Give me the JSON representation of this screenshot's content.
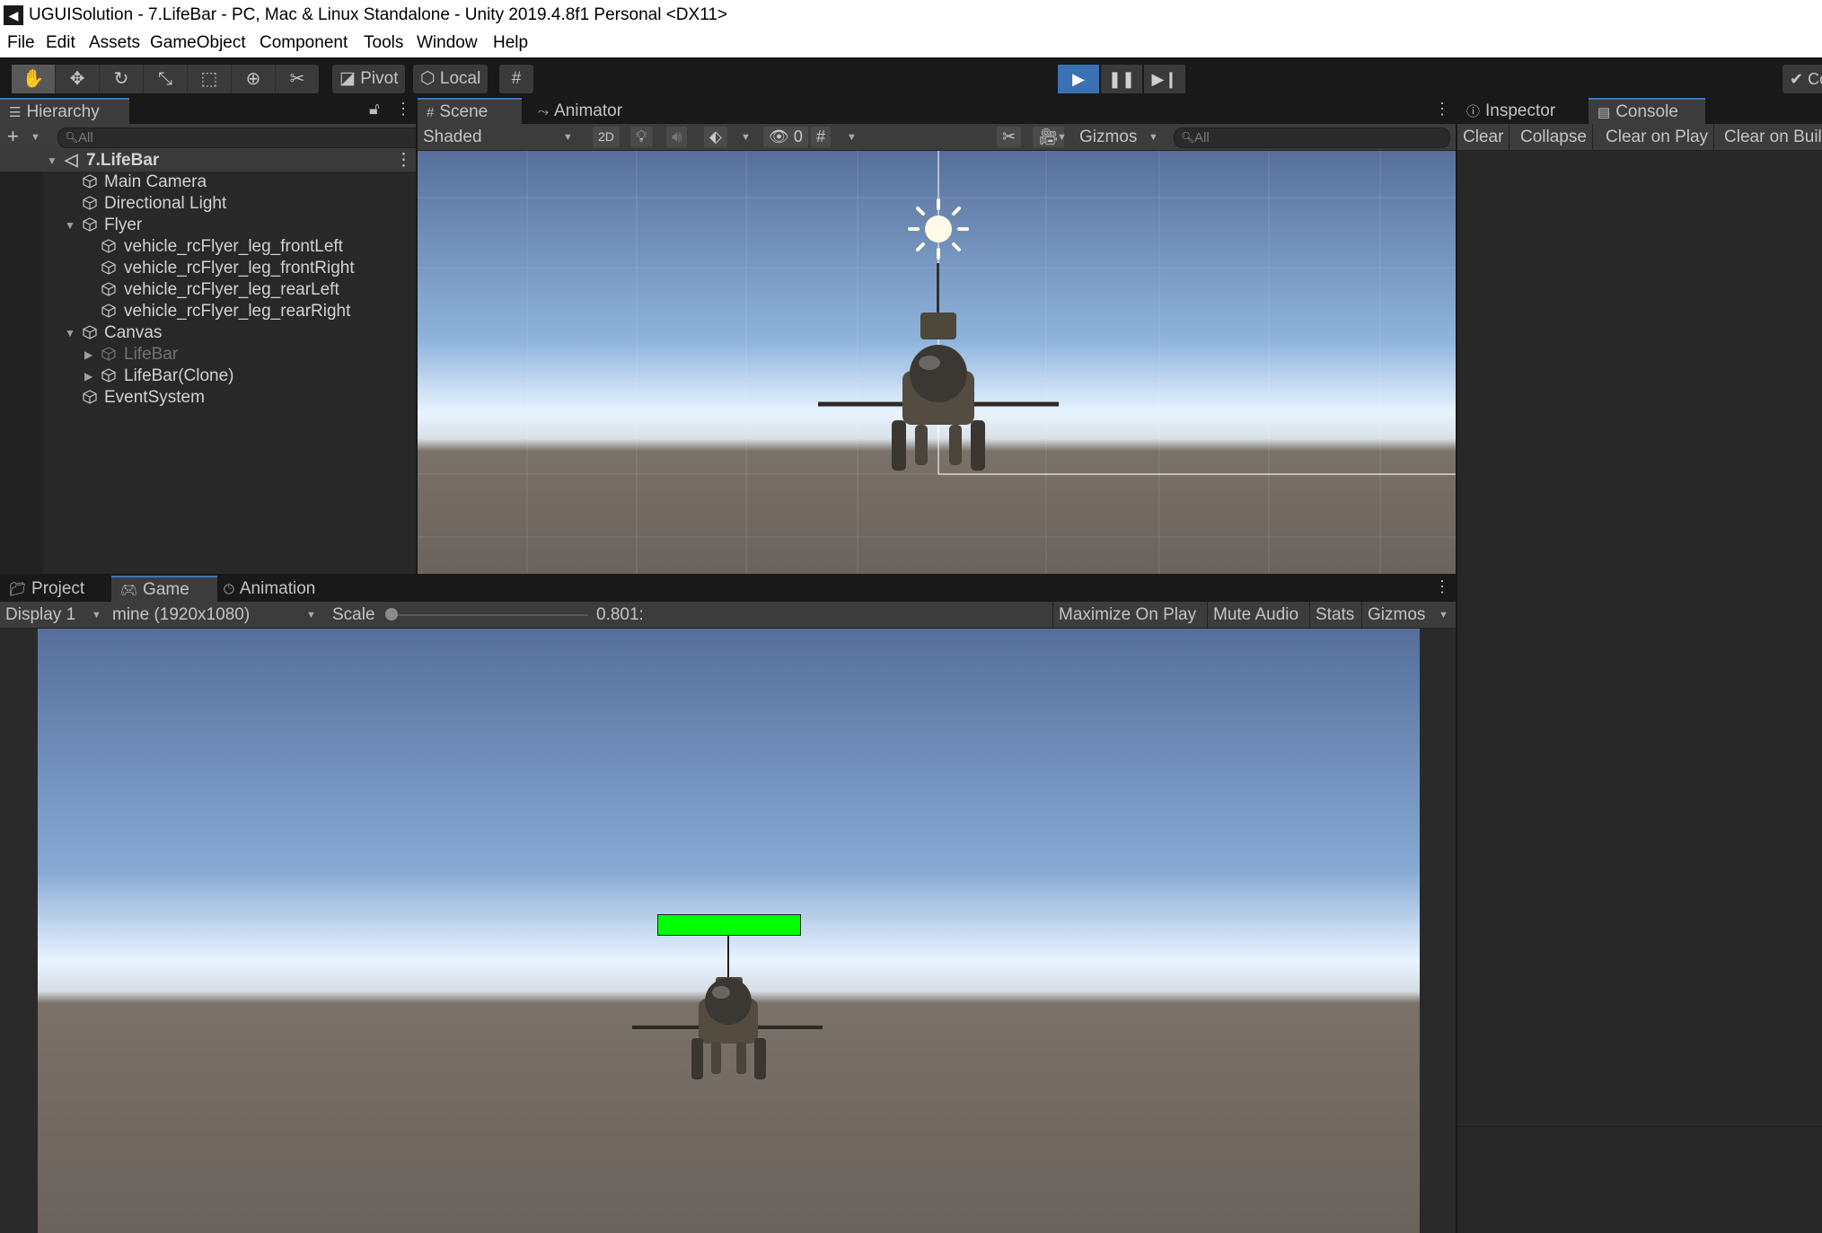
{
  "window": {
    "title": "UGUISolution - 7.LifeBar - PC, Mac & Linux Standalone - Unity 2019.4.8f1 Personal <DX11>"
  },
  "menu": [
    "File",
    "Edit",
    "Assets",
    "GameObject",
    "Component",
    "Tools",
    "Window",
    "Help"
  ],
  "toolbar": {
    "pivot_label": "Pivot",
    "local_label": "Local",
    "collab_label": "Co"
  },
  "hierarchy": {
    "tab_label": "Hierarchy",
    "search_placeholder": "All",
    "scene_name": "7.LifeBar",
    "items": [
      {
        "label": "Main Camera",
        "depth": 1
      },
      {
        "label": "Directional Light",
        "depth": 1
      },
      {
        "label": "Flyer",
        "depth": 1,
        "expanded": true
      },
      {
        "label": "vehicle_rcFlyer_leg_frontLeft",
        "depth": 2
      },
      {
        "label": "vehicle_rcFlyer_leg_frontRight",
        "depth": 2
      },
      {
        "label": "vehicle_rcFlyer_leg_rearLeft",
        "depth": 2
      },
      {
        "label": "vehicle_rcFlyer_leg_rearRight",
        "depth": 2
      },
      {
        "label": "Canvas",
        "depth": 1,
        "expanded": true
      },
      {
        "label": "LifeBar",
        "depth": 2,
        "collapsed": true,
        "inactive": true
      },
      {
        "label": "LifeBar(Clone)",
        "depth": 2,
        "collapsed": true
      },
      {
        "label": "EventSystem",
        "depth": 1
      }
    ]
  },
  "scene": {
    "tabs": [
      "Scene",
      "Animator"
    ],
    "shading_mode": "Shaded",
    "mode_2d": "2D",
    "hidden_count": "0",
    "gizmos_label": "Gizmos",
    "search_placeholder": "All"
  },
  "game": {
    "tabs": [
      "Project",
      "Game",
      "Animation"
    ],
    "display": "Display 1",
    "resolution": "mine (1920x1080)",
    "scale_label": "Scale",
    "scale_value": "0.801:",
    "maximize_label": "Maximize On Play",
    "mute_label": "Mute Audio",
    "stats_label": "Stats",
    "gizmos_label": "Gizmos",
    "lifebar_fill": 1.0
  },
  "console": {
    "tabs": [
      "Inspector",
      "Console"
    ],
    "buttons": [
      "Clear",
      "Collapse",
      "Clear on Play",
      "Clear on Build"
    ]
  },
  "colors": {
    "accent": "#3a79bb",
    "play_active": "#3a71b2",
    "lifebar": "#00ff00",
    "sky_top": "#566f9b",
    "ground": "#6a625c"
  }
}
